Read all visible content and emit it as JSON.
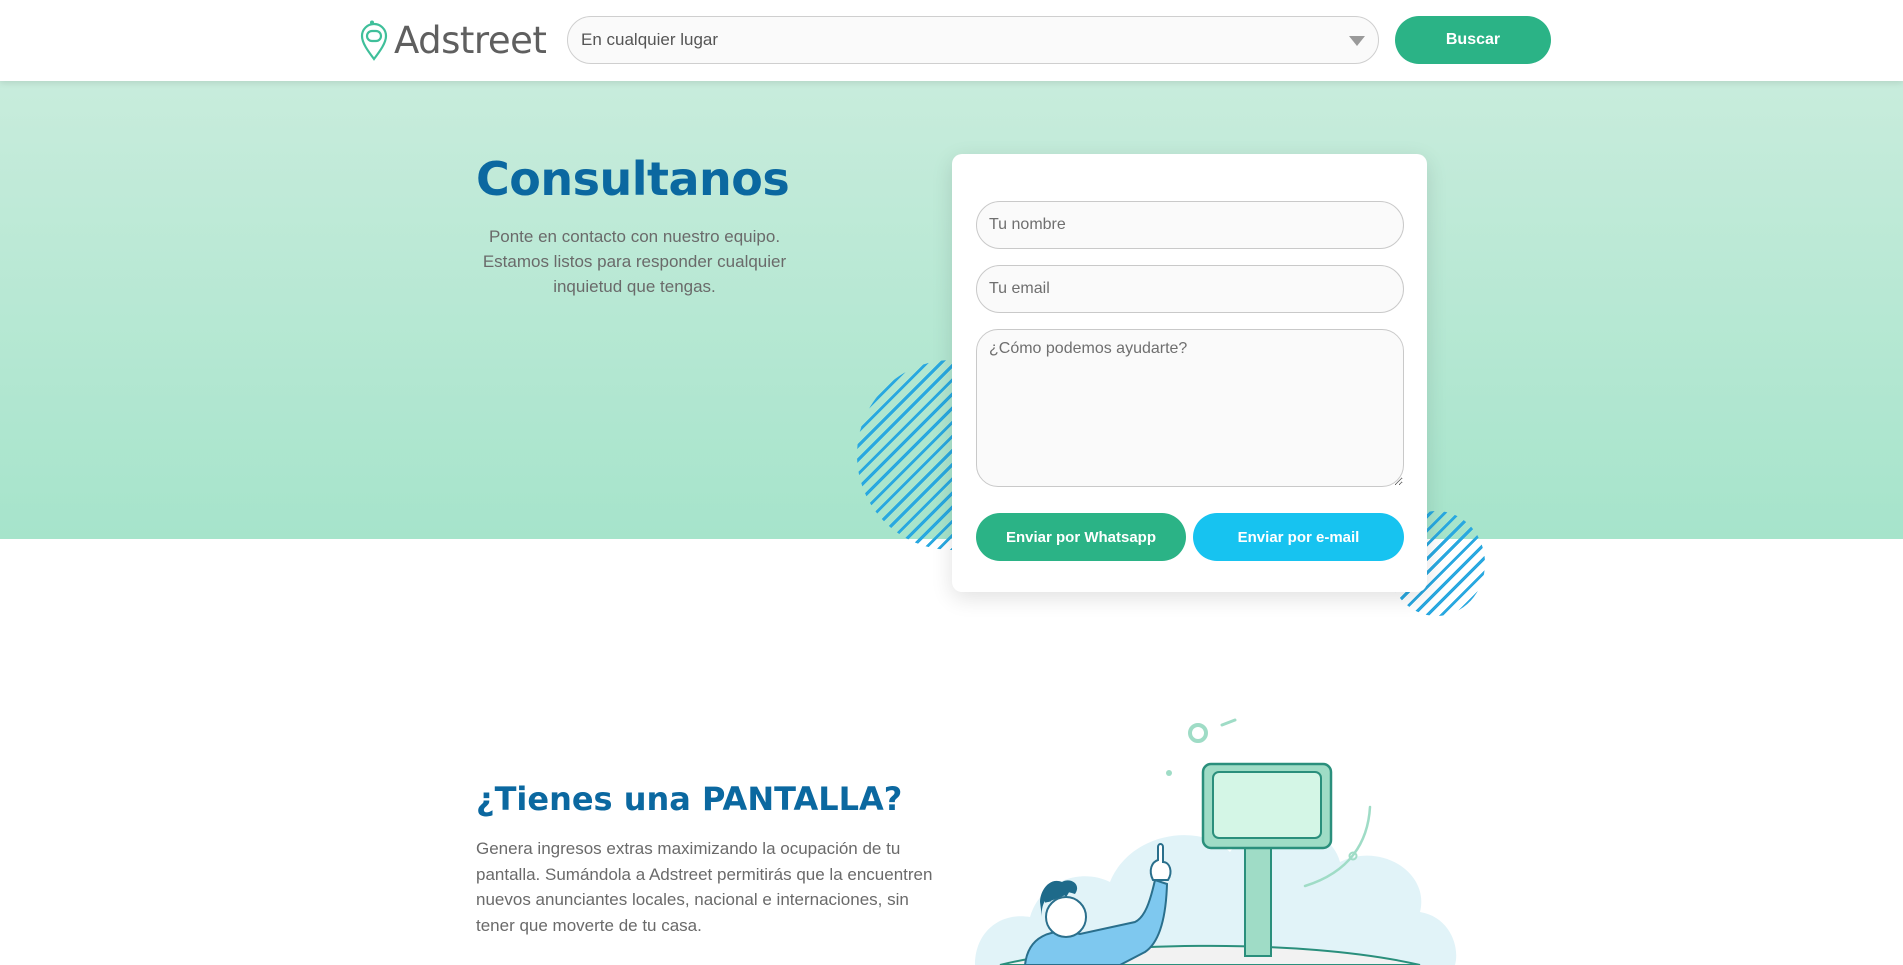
{
  "header": {
    "logo_text": "Adstreet",
    "location_value": "En cualquier lugar",
    "search_label": "Buscar"
  },
  "hero": {
    "title": "Consultanos",
    "description": "Ponte en contacto con nuestro equipo. Estamos listos para responder cualquier inquietud que tengas."
  },
  "form": {
    "name_placeholder": "Tu nombre",
    "email_placeholder": "Tu email",
    "message_placeholder": "¿Cómo podemos ayudarte?",
    "whatsapp_label": "Enviar por Whatsapp",
    "email_label": "Enviar por e-mail"
  },
  "screens": {
    "title": "¿Tienes una PANTALLA?",
    "description": "Genera ingresos extras maximizando la ocupación de tu pantalla. Sumándola a Adstreet permitirás que la encuentren nuevos anunciantes locales, nacional e internaciones, sin tener que moverte de tu casa."
  },
  "colors": {
    "brand_green": "#2bb386",
    "brand_blue": "#0b68a0",
    "accent_cyan": "#17c3f0",
    "hero_bg_top": "#c8ecdc",
    "hero_bg_bottom": "#a6e4cb"
  },
  "icons": {
    "logo": "location-pin-icon",
    "dropdown": "caret-down-icon"
  }
}
